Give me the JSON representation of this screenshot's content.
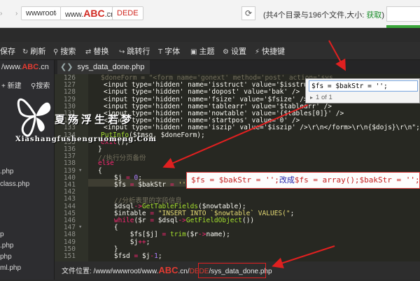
{
  "topbar": {
    "crumb1": "wwwroot",
    "crumb2_prefix": "www.",
    "crumb2_brand": "ABC",
    "crumb2_suffix": ".cn",
    "crumb3": "DEDE",
    "dir_info": "(共4个目录与196个文件,大小: ",
    "dir_info_link": "获取",
    "dir_info_end": ")"
  },
  "toolbar": {
    "items": [
      {
        "label": "保存",
        "icon": "save-icon"
      },
      {
        "label": "刷新",
        "icon": "refresh-icon"
      },
      {
        "label": "搜索",
        "icon": "search-icon"
      },
      {
        "label": "替换",
        "icon": "replace-icon"
      },
      {
        "label": "跳转行",
        "icon": "goto-line-icon"
      },
      {
        "label": "字体",
        "icon": "font-icon"
      },
      {
        "label": "主题",
        "icon": "theme-icon"
      },
      {
        "label": "设置",
        "icon": "gear-icon"
      },
      {
        "label": "快捷键",
        "icon": "lightning-icon"
      }
    ]
  },
  "sidebar": {
    "path_prefix": "/www.",
    "path_brand": "ABC",
    "path_suffix": ".cn",
    "new_label": "新建",
    "search_label": "搜索",
    "files": [
      ".php",
      "class.php",
      "p",
      ".php",
      "php",
      "ml.php",
      "php"
    ]
  },
  "tab": {
    "title": "sys_data_done.php"
  },
  "editor": {
    "line_numbers": [
      "126",
      "127",
      "128",
      "129",
      "130",
      "131",
      "132",
      "133",
      "134",
      "135",
      "136",
      "137",
      "138",
      "139",
      "140",
      "141",
      "142",
      "143",
      "144",
      "145",
      "146",
      "147",
      "148",
      "149",
      "150",
      "151"
    ],
    "find_value": "$fs = $bakStr = '';",
    "find_count": "1 of 1"
  },
  "logo": {
    "cn": "夏殇浮生若梦",
    "en": "Xiashangfushengruomeng.Com"
  },
  "annotation": {
    "old": "$fs = $bakStr = '';",
    "mid": "改成",
    "new": "$fs = array();$bakStr = '';"
  },
  "status": {
    "label": "文件位置:",
    "path_prefix": " /www/wwwroot/www.",
    "brand": "ABC",
    "path_mid": ".cn/",
    "dede": "DEDE",
    "file": "/sys_data_done.php"
  }
}
